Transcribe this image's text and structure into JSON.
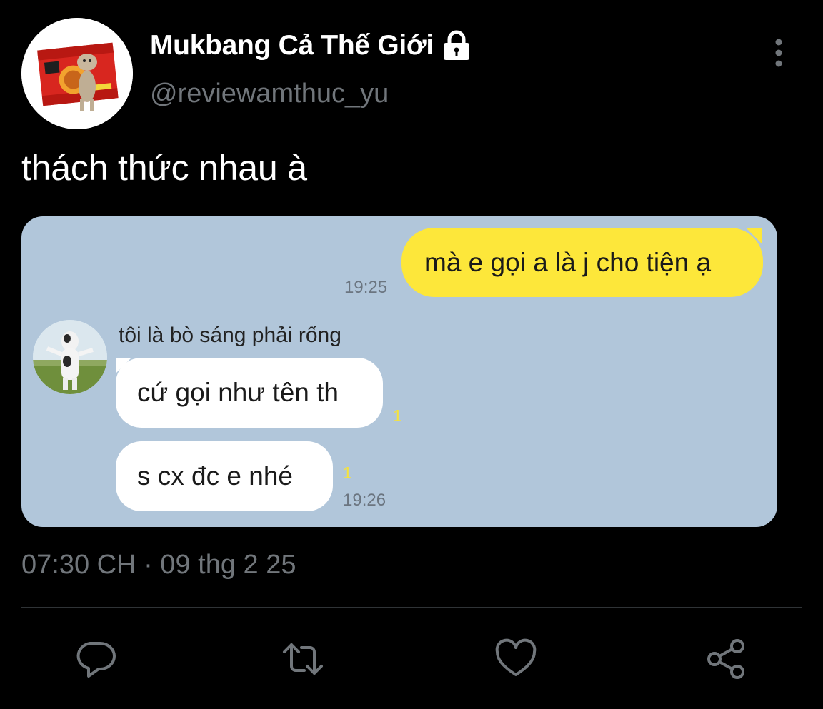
{
  "header": {
    "display_name": "Mukbang Cả Thế Giới",
    "handle": "@reviewamthuc_yu",
    "protected_icon": "lock-icon",
    "menu_icon": "more-vertical-icon"
  },
  "tweet": {
    "text": "thách thức nhau à",
    "timestamp": "07:30 CH · 09 thg 2 25"
  },
  "chat": {
    "messages": [
      {
        "side": "right",
        "text": "mà e gọi a là j cho tiện ạ",
        "time": "19:25"
      },
      {
        "side": "left",
        "text": "cứ gọi như tên th",
        "read": "1"
      },
      {
        "side": "left",
        "text": "s cx đc e nhé",
        "read": "1",
        "time": "19:26"
      }
    ],
    "sender_name": "tôi là bò sáng phải rống"
  },
  "actions": [
    {
      "name": "reply",
      "icon": "reply-icon"
    },
    {
      "name": "retweet",
      "icon": "retweet-icon"
    },
    {
      "name": "like",
      "icon": "heart-icon"
    },
    {
      "name": "share",
      "icon": "share-icon"
    }
  ],
  "colors": {
    "background": "#000000",
    "muted_text": "#71767b",
    "chat_background": "#b1c6da",
    "my_bubble": "#fde73a",
    "their_bubble": "#ffffff",
    "read_counter": "#f5e23d"
  }
}
